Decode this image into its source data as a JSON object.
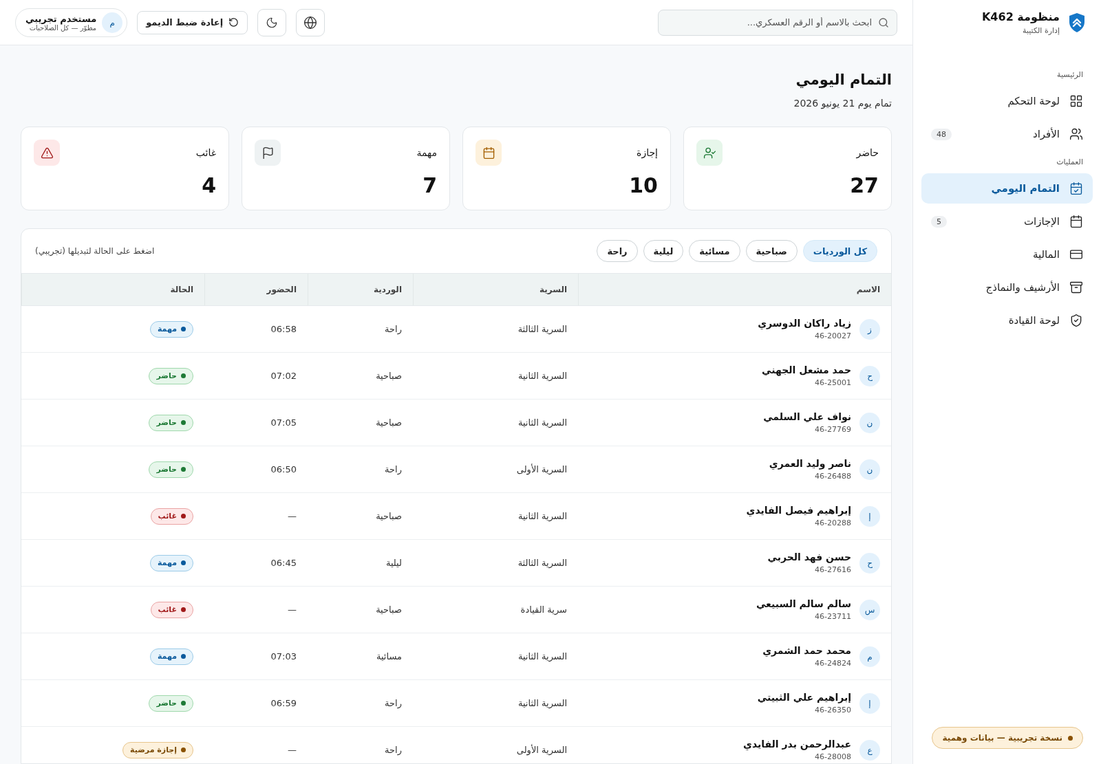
{
  "brand": {
    "title": "منظومة K462",
    "subtitle": "إدارة الكتيبة"
  },
  "topbar": {
    "search": {
      "placeholder": "ابحث بالاسم أو الرقم العسكري..."
    },
    "reset_button": "إعادة ضبط الديمو",
    "user": {
      "initial": "م",
      "name": "مستخدم تجريبي",
      "role": "مطوّر — كل الصلاحيات"
    }
  },
  "sidebar": {
    "sections": [
      {
        "title": "الرئيسية",
        "items": [
          {
            "label": "لوحة التحكم",
            "selected": false
          },
          {
            "label": "الأفراد",
            "badge": "48",
            "selected": false
          }
        ]
      },
      {
        "title": "العمليات",
        "items": [
          {
            "label": "التمام اليومي",
            "selected": true
          },
          {
            "label": "الإجازات",
            "badge": "5",
            "selected": false
          },
          {
            "label": "المالية",
            "selected": false
          },
          {
            "label": "الأرشيف والنماذج",
            "selected": false
          },
          {
            "label": "لوحة القيادة",
            "selected": false
          }
        ]
      }
    ],
    "demo_badge": "نسخة تجريبية — بيانات وهمية"
  },
  "page": {
    "title": "التمام اليومي",
    "subtitle": "تمام يوم 21 يونيو 2026"
  },
  "stats": [
    {
      "kind": "present",
      "label": "حاضر",
      "value": "27"
    },
    {
      "kind": "leave",
      "label": "إجازة",
      "value": "10"
    },
    {
      "kind": "mission",
      "label": "مهمة",
      "value": "7"
    },
    {
      "kind": "absent",
      "label": "غائب",
      "value": "4"
    }
  ],
  "filters": [
    {
      "label": "كل الورديات",
      "selected": true
    },
    {
      "label": "صباحية",
      "selected": false
    },
    {
      "label": "مسائية",
      "selected": false
    },
    {
      "label": "ليلية",
      "selected": false
    },
    {
      "label": "راحة",
      "selected": false
    }
  ],
  "hint": "اضغط على الحالة لتبديلها (تجريبي)",
  "table": {
    "columns": [
      "الاسم",
      "السرية",
      "الوردية",
      "الحضور",
      "الحالة"
    ],
    "rows": [
      {
        "initial": "ز",
        "name": "زياد راكان الدوسري",
        "number": "46-20027",
        "company": "السرية الثالثة",
        "shift": "راحة",
        "time": "06:58",
        "status": {
          "label": "مهمة",
          "kind": "mission"
        }
      },
      {
        "initial": "ح",
        "name": "حمد مشعل الجهني",
        "number": "46-25001",
        "company": "السرية الثانية",
        "shift": "صباحية",
        "time": "07:02",
        "status": {
          "label": "حاضر",
          "kind": "present"
        }
      },
      {
        "initial": "ن",
        "name": "نواف علي السلمي",
        "number": "46-27769",
        "company": "السرية الثانية",
        "shift": "صباحية",
        "time": "07:05",
        "status": {
          "label": "حاضر",
          "kind": "present"
        }
      },
      {
        "initial": "ن",
        "name": "ناصر وليد العمري",
        "number": "46-26488",
        "company": "السرية الأولى",
        "shift": "راحة",
        "time": "06:50",
        "status": {
          "label": "حاضر",
          "kind": "present"
        }
      },
      {
        "initial": "إ",
        "name": "إبراهيم فيصل الفايدي",
        "number": "46-20288",
        "company": "السرية الثانية",
        "shift": "صباحية",
        "time": "—",
        "status": {
          "label": "غائب",
          "kind": "absent"
        }
      },
      {
        "initial": "ح",
        "name": "حسن فهد الحربي",
        "number": "46-27616",
        "company": "السرية الثالثة",
        "shift": "ليلية",
        "time": "06:45",
        "status": {
          "label": "مهمة",
          "kind": "mission"
        }
      },
      {
        "initial": "س",
        "name": "سالم سالم السبيعي",
        "number": "46-23711",
        "company": "سرية القيادة",
        "shift": "صباحية",
        "time": "—",
        "status": {
          "label": "غائب",
          "kind": "absent"
        }
      },
      {
        "initial": "م",
        "name": "محمد حمد الشمري",
        "number": "46-24824",
        "company": "السرية الثانية",
        "shift": "مسائية",
        "time": "07:03",
        "status": {
          "label": "مهمة",
          "kind": "mission"
        }
      },
      {
        "initial": "إ",
        "name": "إبراهيم علي الثبيتي",
        "number": "46-26350",
        "company": "السرية الثانية",
        "shift": "راحة",
        "time": "06:59",
        "status": {
          "label": "حاضر",
          "kind": "present"
        }
      },
      {
        "initial": "ع",
        "name": "عبدالرحمن بدر الفايدي",
        "number": "46-28008",
        "company": "السرية الأولى",
        "shift": "راحة",
        "time": "—",
        "status": {
          "label": "إجازة مرضية",
          "kind": "sick"
        }
      }
    ]
  }
}
